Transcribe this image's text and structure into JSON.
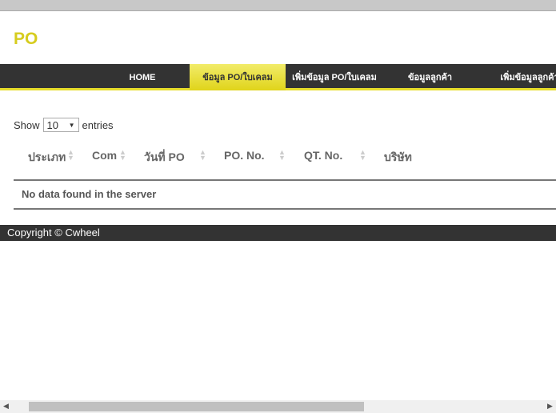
{
  "header": {
    "title": "PO"
  },
  "nav": {
    "items": [
      {
        "label": "HOME"
      },
      {
        "label": "ข้อมูล PO/ใบเคลม",
        "active": true
      },
      {
        "label": "เพิ่มข้อมูล PO/ใบเคลม"
      },
      {
        "label": "ข้อมูลลูกค้า"
      },
      {
        "label": "เพิ่มข้อมูลลูกค้า"
      }
    ]
  },
  "table": {
    "show_label": "Show",
    "entries_value": "10",
    "entries_label": "entries",
    "columns": [
      "ประเภท",
      "Com",
      "วันที่ PO",
      "PO. No.",
      "QT. No.",
      "บริษัท"
    ],
    "empty_message": "No data found in the server"
  },
  "footer": {
    "copyright": "Copyright © Cwheel"
  },
  "colors": {
    "accent": "#d6cc1e",
    "nav_bg": "#333333"
  }
}
